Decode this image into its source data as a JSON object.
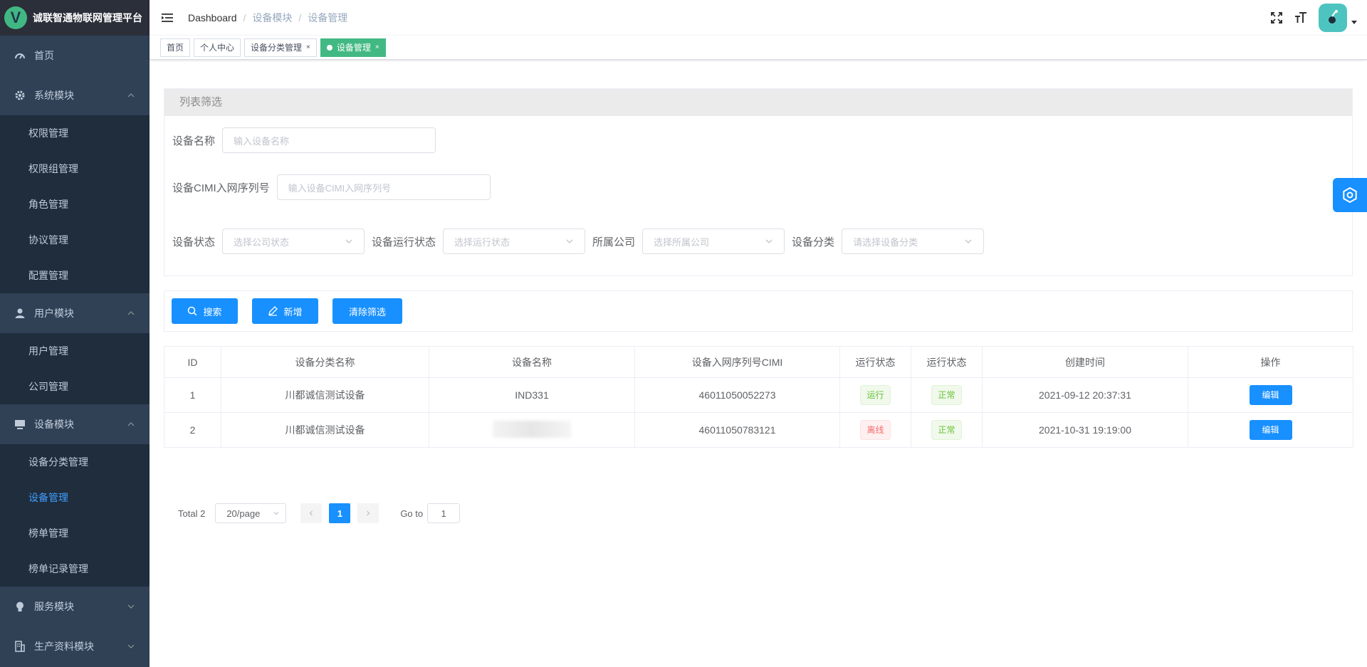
{
  "app": {
    "title": "诚联智通物联网管理平台",
    "logo_letter": "V"
  },
  "sidebar": {
    "home": "首页",
    "groups": [
      {
        "label": "系统模块",
        "icon": "gear-icon",
        "items": [
          "权限管理",
          "权限组管理",
          "角色管理",
          "协议管理",
          "配置管理"
        ]
      },
      {
        "label": "用户模块",
        "icon": "user-icon",
        "items": [
          "用户管理",
          "公司管理"
        ]
      },
      {
        "label": "设备模块",
        "icon": "monitor-icon",
        "items": [
          "设备分类管理",
          "设备管理",
          "榜单管理",
          "榜单记录管理"
        ]
      }
    ],
    "collapsed": [
      {
        "label": "服务模块",
        "icon": "bulb-icon"
      },
      {
        "label": "生产资料模块",
        "icon": "building-icon"
      }
    ],
    "active_item": "设备管理"
  },
  "breadcrumb": [
    "Dashboard",
    "设备模块",
    "设备管理"
  ],
  "tags": [
    {
      "label": "首页",
      "closable": false,
      "active": false
    },
    {
      "label": "个人中心",
      "closable": false,
      "active": false
    },
    {
      "label": "设备分类管理",
      "closable": true,
      "active": false
    },
    {
      "label": "设备管理",
      "closable": true,
      "active": true
    }
  ],
  "filter": {
    "title": "列表筛选",
    "device_name_label": "设备名称",
    "device_name_placeholder": "输入设备名称",
    "cimi_label": "设备CIMI入网序列号",
    "cimi_placeholder": "输入设备CIMI入网序列号",
    "status_label": "设备状态",
    "status_placeholder": "选择公司状态",
    "run_status_label": "设备运行状态",
    "run_status_placeholder": "选择运行状态",
    "company_label": "所属公司",
    "company_placeholder": "选择所属公司",
    "category_label": "设备分类",
    "category_placeholder": "请选择设备分类"
  },
  "actions": {
    "search": "搜索",
    "add": "新增",
    "clear": "清除筛选"
  },
  "table": {
    "headers": [
      "ID",
      "设备分类名称",
      "设备名称",
      "设备入网序列号CIMI",
      "运行状态",
      "运行状态",
      "创建时间",
      "操作"
    ],
    "rows": [
      {
        "id": "1",
        "category": "川都诚信测试设备",
        "name": "IND331",
        "cimi": "46011050052273",
        "run": "运行",
        "run_type": "success",
        "status": "正常",
        "created": "2021-09-12 20:37:31",
        "action": "编辑"
      },
      {
        "id": "2",
        "category": "川都诚信测试设备",
        "name": "",
        "cimi": "46011050783121",
        "run": "离线",
        "run_type": "danger",
        "status": "正常",
        "created": "2021-10-31 19:19:00",
        "action": "编辑"
      }
    ]
  },
  "pagination": {
    "total": "Total 2",
    "page_size": "20/page",
    "current": "1",
    "goto_label": "Go to",
    "goto_value": "1"
  },
  "colors": {
    "sidebar_bg": "#304156",
    "primary": "#1890ff",
    "tag_active": "#42b983",
    "menu_active": "#409eff"
  }
}
